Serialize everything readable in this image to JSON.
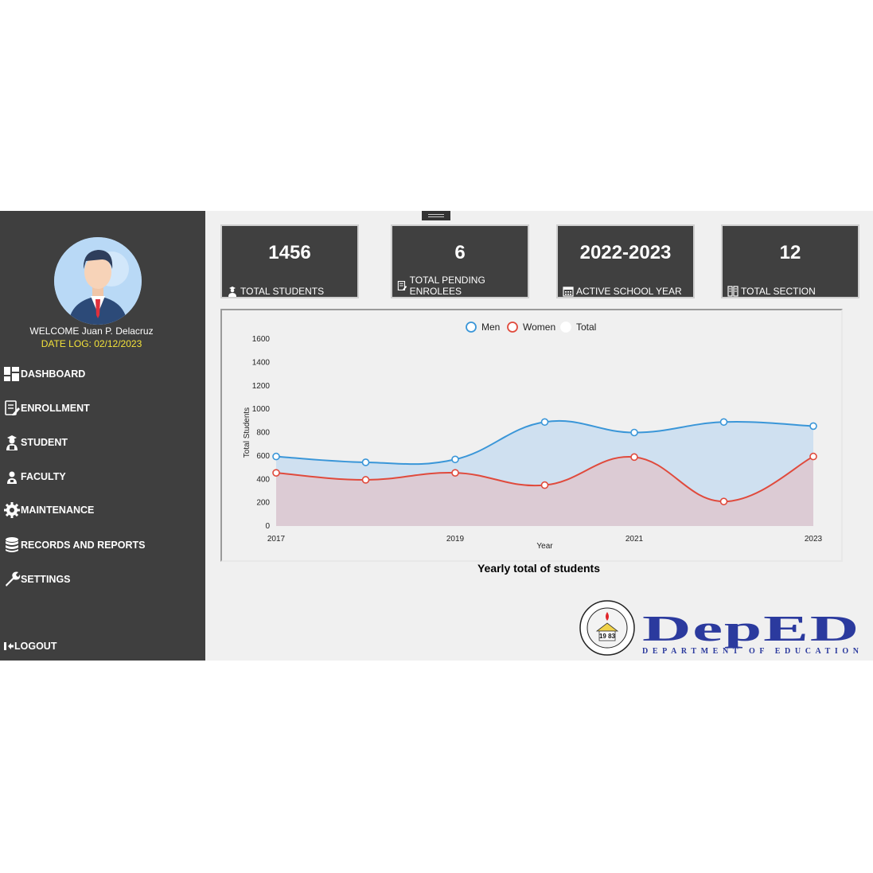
{
  "user": {
    "welcome": "WELCOME Juan P. Delacruz",
    "date_log": "DATE LOG: 02/12/2023"
  },
  "nav": [
    {
      "label": "DASHBOARD",
      "icon": "dashboard-icon"
    },
    {
      "label": "ENROLLMENT",
      "icon": "enrollment-icon"
    },
    {
      "label": "STUDENT",
      "icon": "student-icon"
    },
    {
      "label": "FACULTY",
      "icon": "faculty-icon"
    },
    {
      "label": "MAINTENANCE",
      "icon": "gear-icon"
    },
    {
      "label": "RECORDS AND REPORTS",
      "icon": "database-icon"
    },
    {
      "label": "SETTINGS",
      "icon": "wrench-icon"
    }
  ],
  "logout": "LOGOUT",
  "cards": [
    {
      "value": "1456",
      "label": "TOTAL STUDENTS",
      "icon": "student-icon"
    },
    {
      "value": "6",
      "label": "TOTAL PENDING ENROLEES",
      "icon": "document-icon"
    },
    {
      "value": "2022-2023",
      "label": "ACTIVE SCHOOL YEAR",
      "icon": "calendar-icon"
    },
    {
      "value": "12",
      "label": "TOTAL SECTION",
      "icon": "section-icon"
    }
  ],
  "chart_data": {
    "type": "area",
    "title": "Yearly total of students",
    "xlabel": "Year",
    "ylabel": "Total Students",
    "ylim": [
      0,
      1600
    ],
    "yticks": [
      0,
      200,
      400,
      600,
      800,
      1000,
      1200,
      1400,
      1600
    ],
    "xticks": [
      "2017",
      "2019",
      "2021",
      "2023"
    ],
    "x": [
      2017,
      2018,
      2019,
      2020,
      2021,
      2022,
      2023
    ],
    "legend_position": "top-center",
    "series": [
      {
        "name": "Men",
        "color": "#3a96d8",
        "fill": "#cfe0f0",
        "values": [
          595,
          545,
          570,
          890,
          800,
          890,
          855
        ]
      },
      {
        "name": "Women",
        "color": "#e04a3c",
        "fill": "#dccbd4",
        "values": [
          455,
          395,
          455,
          350,
          590,
          210,
          595
        ]
      },
      {
        "name": "Total",
        "color": "#ffffff",
        "fill": "none",
        "values": []
      }
    ]
  },
  "logos": {
    "school_seal_year": "19 83",
    "deped_text": "DepED",
    "deped_sub": "DEPARTMENT OF EDUCATION"
  },
  "colors": {
    "sidebar": "#3f3f3f",
    "card": "#404040",
    "date_log": "#f4e33a",
    "deped_blue": "#2b3a9e",
    "deped_red": "#e0252a"
  }
}
